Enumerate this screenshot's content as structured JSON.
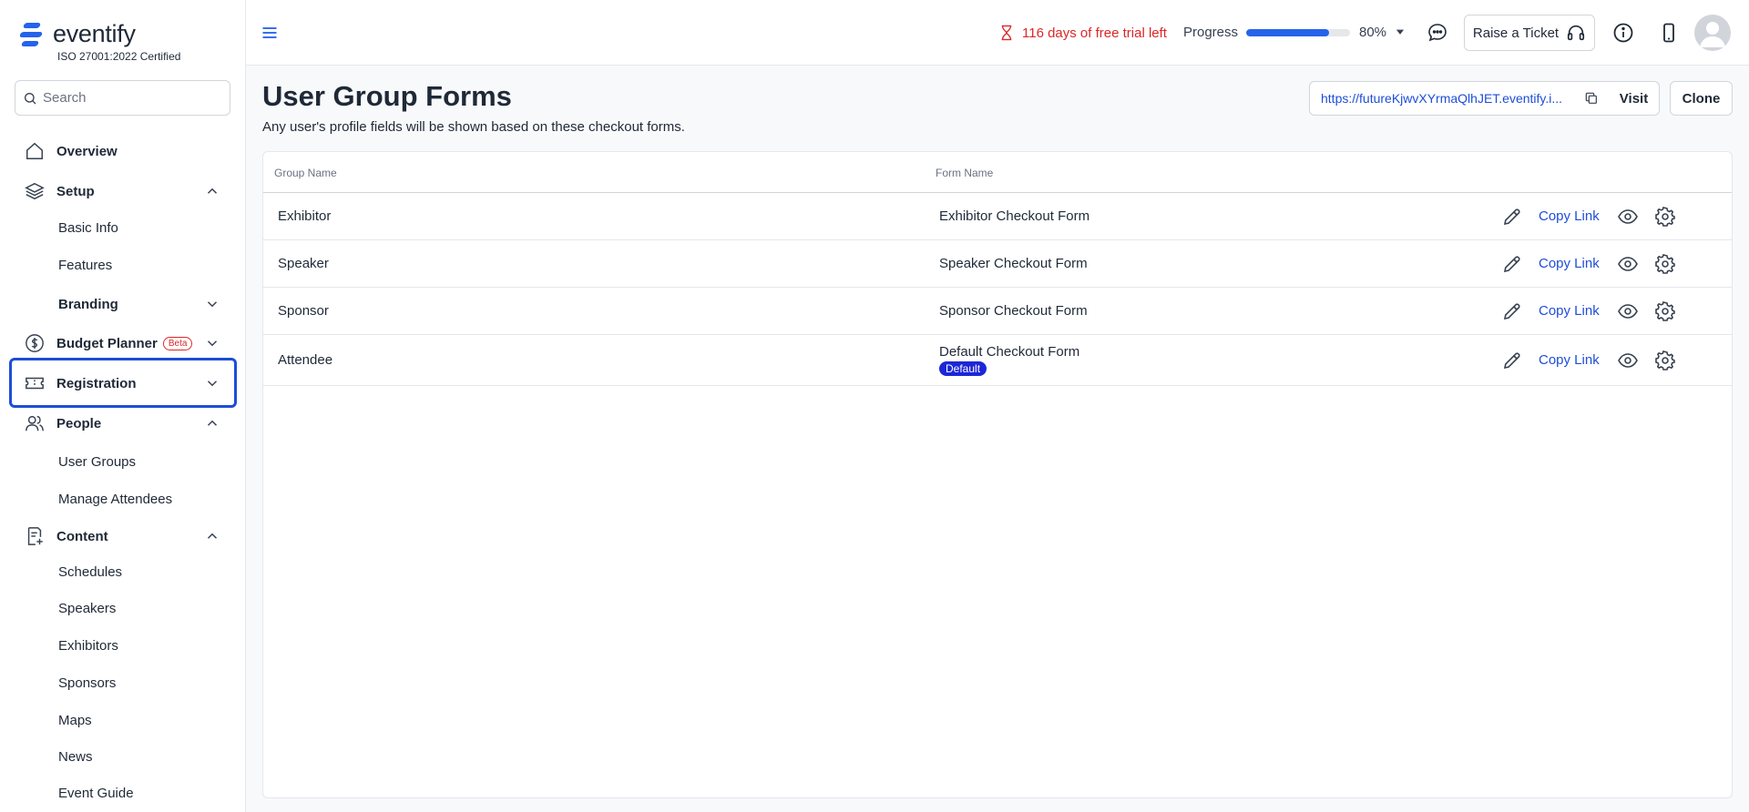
{
  "brand": {
    "name": "eventify",
    "cert": "ISO 27001:2022 Certified",
    "color": "#2563eb"
  },
  "search": {
    "placeholder": "Search"
  },
  "sidebar": {
    "overview": "Overview",
    "setup": "Setup",
    "basic_info": "Basic Info",
    "features": "Features",
    "branding": "Branding",
    "budget_planner": "Budget Planner",
    "beta": "Beta",
    "registration": "Registration",
    "people": "People",
    "user_groups": "User Groups",
    "manage_attendees": "Manage Attendees",
    "content": "Content",
    "schedules": "Schedules",
    "speakers": "Speakers",
    "exhibitors": "Exhibitors",
    "sponsors": "Sponsors",
    "maps": "Maps",
    "news": "News",
    "event_guide": "Event Guide"
  },
  "topbar": {
    "trial": "116 days of free trial left",
    "progress_label": "Progress",
    "progress_pct": 80,
    "progress_text": "80%",
    "ticket": "Raise a Ticket"
  },
  "main": {
    "title": "User Group Forms",
    "subtitle": "Any user's profile fields will be shown based on these checkout forms.",
    "url": "https://futureKjwvXYrmaQlhJET.eventify.i...",
    "visit": "Visit",
    "clone": "Clone",
    "columns": [
      "Group Name",
      "Form Name"
    ],
    "copy_link": "Copy Link",
    "default_badge": "Default",
    "rows": [
      {
        "group": "Exhibitor",
        "form": "Exhibitor Checkout Form"
      },
      {
        "group": "Speaker",
        "form": "Speaker Checkout Form"
      },
      {
        "group": "Sponsor",
        "form": "Sponsor Checkout Form"
      },
      {
        "group": "Attendee",
        "form": "Default Checkout Form"
      }
    ]
  }
}
